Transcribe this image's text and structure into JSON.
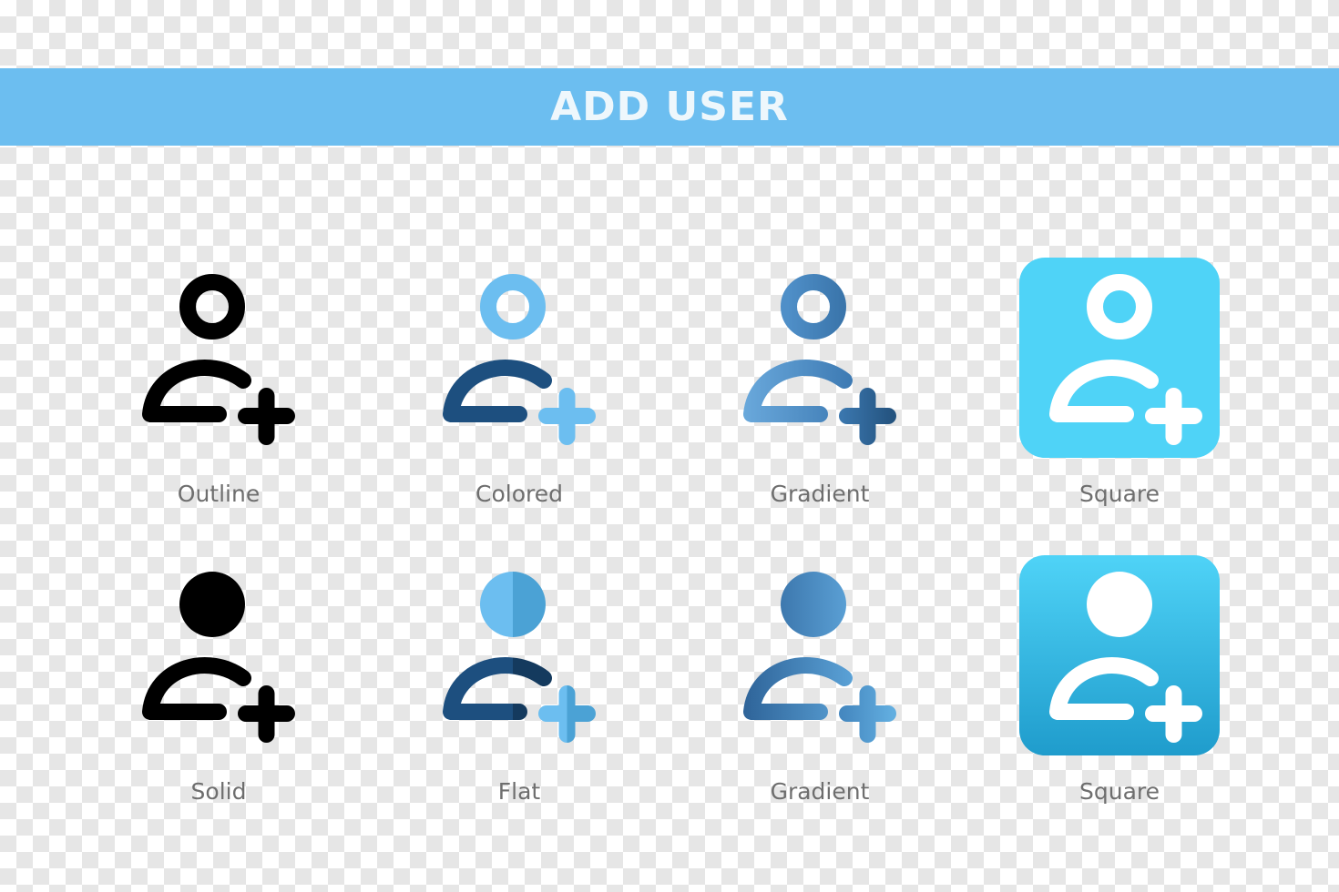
{
  "header": {
    "title": "ADD USER",
    "background_color": "#6cbef0"
  },
  "icons": [
    {
      "label": "Outline",
      "style": "outline"
    },
    {
      "label": "Colored",
      "style": "colored"
    },
    {
      "label": "Gradient",
      "style": "gradient-outline"
    },
    {
      "label": "Square",
      "style": "square-outline"
    },
    {
      "label": "Solid",
      "style": "solid"
    },
    {
      "label": "Flat",
      "style": "flat"
    },
    {
      "label": "Gradient",
      "style": "gradient-solid"
    },
    {
      "label": "Square",
      "style": "square-solid"
    }
  ],
  "colors": {
    "black": "#000000",
    "light_blue": "#6cbef0",
    "mid_blue": "#4a9fd6",
    "dark_blue": "#1d4f7f",
    "darker_blue": "#143a5e",
    "gradient_start": "#6aa9dc",
    "gradient_end": "#2c5f93",
    "square_top": "#4fd3f7",
    "square_bottom": "#23a3d2",
    "white": "#ffffff",
    "label_gray": "#6e6e6e"
  }
}
